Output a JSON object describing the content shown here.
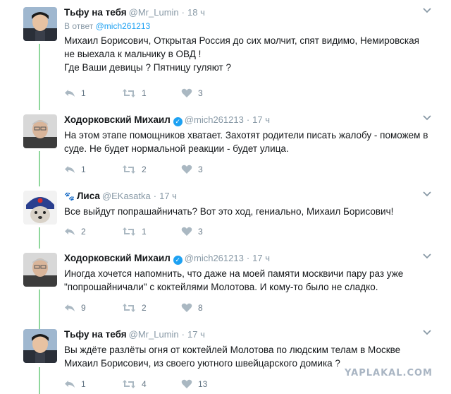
{
  "tweets": [
    {
      "author": "Тьфу на тебя",
      "screen_name": "@Mr_Lumin",
      "time": "18 ч",
      "reply_label": "В ответ",
      "reply_handle": "@mich261213",
      "lines": [
        "Михаил Борисович, Открытая Россия до сих молчит, спят видимо, Немировская",
        "не выехала к мальчику в ОВД !",
        "Где Ваши девицы ? Пятницу гуляют ?"
      ],
      "verified": false,
      "replies": "1",
      "retweets": "1",
      "likes": "3"
    },
    {
      "author": "Ходорковский Михаил",
      "screen_name": "@mich261213",
      "time": "17 ч",
      "lines": [
        "На этом этапе помощников хватает. Захотят родители писать жалобу - поможем в",
        "суде. Не будет нормальной реакции - будет улица."
      ],
      "verified": true,
      "replies": "1",
      "retweets": "2",
      "likes": "3"
    },
    {
      "author": "Лиса",
      "screen_name": "@EKasatka",
      "time": "17 ч",
      "lines": [
        "Все выйдут попрашайничать?  Вот это ход, гениально, Михаил Борисович!"
      ],
      "verified": false,
      "replies": "2",
      "retweets": "1",
      "likes": "3"
    },
    {
      "author": "Ходорковский Михаил",
      "screen_name": "@mich261213",
      "time": "17 ч",
      "lines": [
        "Иногда хочется напомнить, что даже на моей памяти москвичи пару раз уже",
        "\"попрошайничали\" с коктейлями Молотова. И кому-то было не сладко."
      ],
      "verified": true,
      "replies": "9",
      "retweets": "2",
      "likes": "8"
    },
    {
      "author": "Тьфу на тебя",
      "screen_name": "@Mr_Lumin",
      "time": "17 ч",
      "lines": [
        "Вы ждёте разлёты огня от коктейлей Молотова по людским телам в Москве",
        "Михаил Борисович, из своего уютного швейцарского домика ?"
      ],
      "verified": false,
      "replies": "1",
      "retweets": "4",
      "likes": "13"
    }
  ],
  "icons": {
    "reply": "reply-icon",
    "retweet": "retweet-icon",
    "like": "heart-icon",
    "menu": "chevron-down-icon",
    "verified": "verified-badge-icon"
  },
  "colors": {
    "thread_line": "#8fd79c",
    "link": "#1da1f2",
    "muted": "#8899a6"
  },
  "watermark": "YAPLAKAL.COM"
}
